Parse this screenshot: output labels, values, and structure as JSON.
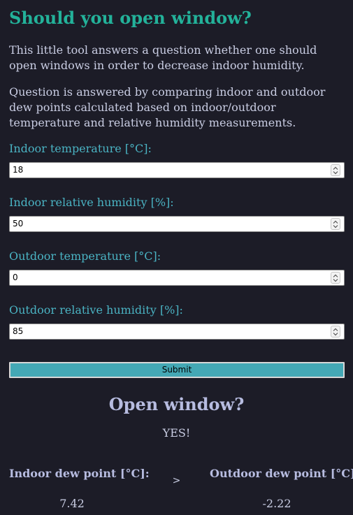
{
  "header": {
    "title": "Should you open window?"
  },
  "intro": {
    "paragraph_1": "This little tool answers a question whether one should open windows in order to decrease indoor humidity.",
    "paragraph_2": "Question is answered by comparing indoor and outdoor dew points calculated based on indoor/outdoor temperature and relative humidity measurements."
  },
  "form": {
    "fields": [
      {
        "label": "Indoor temperature [°C]:",
        "value": "18"
      },
      {
        "label": "Indoor relative humidity [%]:",
        "value": "50"
      },
      {
        "label": "Outdoor temperature [°C]:",
        "value": "0"
      },
      {
        "label": "Outdoor relative humidity [%]:",
        "value": "85"
      }
    ],
    "submit_label": "Submit"
  },
  "result": {
    "title": "Open window?",
    "answer": "YES!",
    "indoor_label": "Indoor dew point [°C]:",
    "indoor_value": "7.42",
    "comparator": ">",
    "outdoor_label": "Outdoor dew point [°C]:",
    "outdoor_value": "-2.22"
  },
  "colors": {
    "background": "#1c1c27",
    "title": "#23b29a",
    "label": "#4ab3c3",
    "submit": "#44a8b5",
    "result_heading": "#b7bce0"
  },
  "icons": {
    "spinner": "spinner-arrows-icon"
  }
}
